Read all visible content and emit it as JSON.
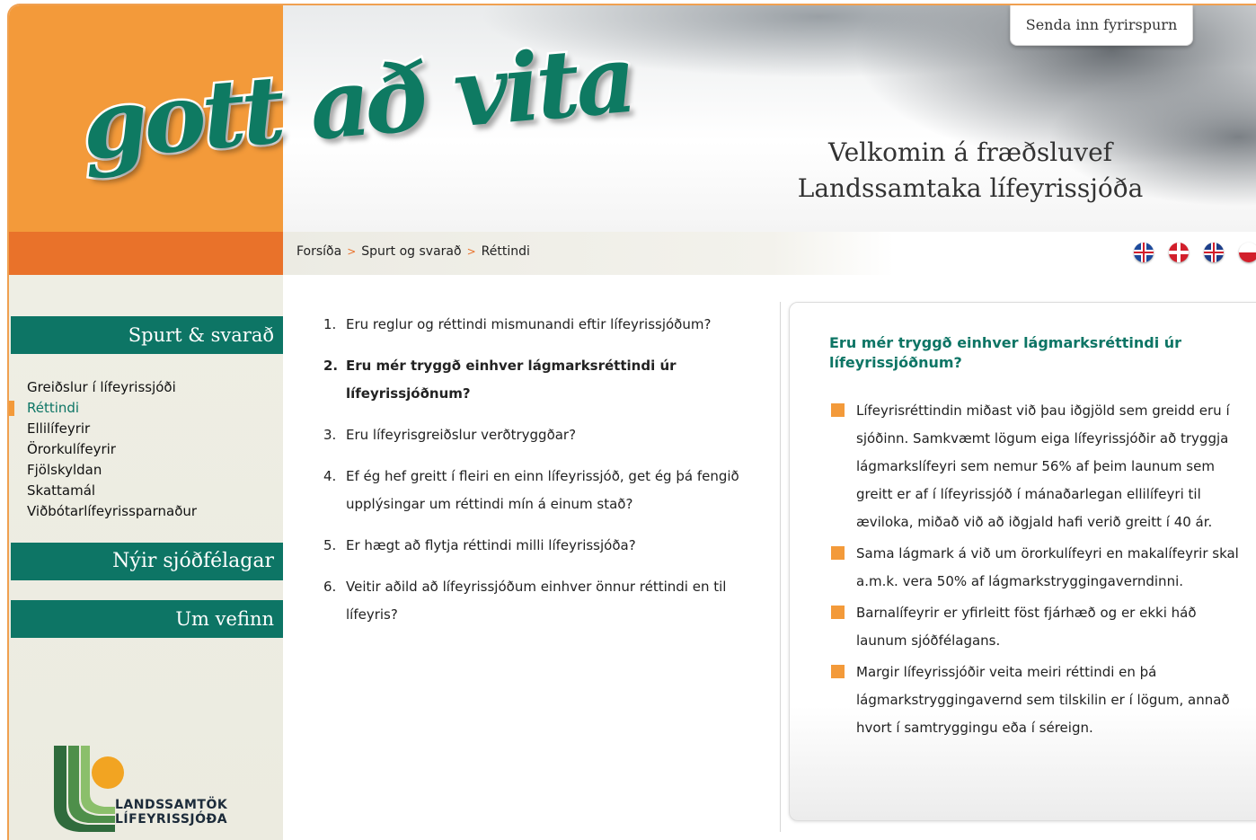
{
  "header": {
    "logo_text": "gott að vita",
    "inquiry_button": "Senda inn fyrirspurn",
    "welcome_line1": "Velkomin á fræðsluvef",
    "welcome_line2": "Landssamtaka lífeyrissjóða"
  },
  "breadcrumb": {
    "items": [
      "Forsíða",
      "Spurt og svarað",
      "Réttindi"
    ],
    "separator": ">"
  },
  "languages": [
    "Íslenska",
    "Dansk",
    "English",
    "Polski"
  ],
  "sidebar": {
    "section1": "Spurt & svarað",
    "items": [
      "Greiðslur í lífeyrissjóði",
      "Réttindi",
      "Ellilífeyrir",
      "Örorkulífeyrir",
      "Fjölskyldan",
      "Skattamál",
      "Viðbótarlífeyrissparnaður"
    ],
    "active_index": 1,
    "section2": "Nýir sjóðfélagar",
    "section3": "Um vefinn",
    "org_name_line1": "LANDSSAMTÖK",
    "org_name_line2": "LÍFEYRISSJÓÐA"
  },
  "questions": [
    {
      "num": "1.",
      "text": "Eru reglur og réttindi mismunandi eftir lífeyrissjóðum?"
    },
    {
      "num": "2.",
      "text": "Eru mér tryggð einhver lágmarksréttindi úr lífeyrissjóðnum?"
    },
    {
      "num": "3.",
      "text": "Eru lífeyrisgreiðslur verðtryggðar?"
    },
    {
      "num": "4.",
      "text": "Ef ég hef greitt í fleiri en einn lífeyrissjóð, get ég þá fengið upplýsingar um réttindi mín á einum stað?"
    },
    {
      "num": "5.",
      "text": "Er hægt að flytja réttindi milli lífeyrissjóða?"
    },
    {
      "num": "6.",
      "text": "Veitir aðild að lífeyrissjóðum einhver önnur réttindi en til lífeyris?"
    }
  ],
  "active_question_index": 1,
  "answer": {
    "title": "Eru mér tryggð einhver lágmarksréttindi úr lífeyrissjóðnum?",
    "bullets": [
      "Lífeyrisréttindin miðast við þau iðgjöld sem greidd eru í sjóðinn. Samkvæmt lögum eiga lífeyrissjóðir að tryggja lágmarkslífeyri sem nemur 56% af þeim launum sem greitt er af í lífeyrissjóð í mánaðarlegan ellilífeyri til æviloka, miðað við að iðgjald hafi verið greitt í 40 ár.",
      "Sama lágmark á við um örorkulífeyri en makalífeyrir skal a.m.k. vera 50% af lágmarkstryggingaverndinni.",
      "Barnalífeyrir er yfirleitt föst fjárhæð og er ekki háð launum sjóðfélagans.",
      "Margir lífeyrissjóðir veita meiri réttindi en þá lágmarkstryggingavernd sem tilskilin er í lögum, annað hvort í samtryggingu eða í séreign."
    ]
  },
  "colors": {
    "orange": "#f39a3a",
    "dark_orange": "#e9722a",
    "teal": "#0d7565"
  }
}
